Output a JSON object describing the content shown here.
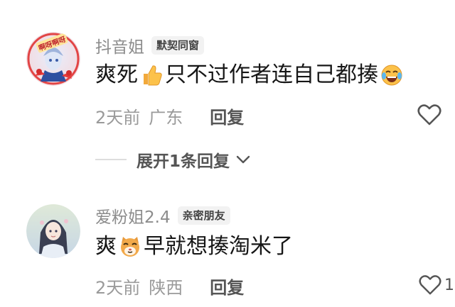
{
  "comments": [
    {
      "username": "抖音姐",
      "badge": "默契同窗",
      "avatar_text": "啊呀啊呀",
      "text_before": "爽死",
      "emoji1": "thumbs-up",
      "text_middle": "只不过作者连自己都揍",
      "emoji2": "laughing-tears",
      "time": "2天前",
      "location": "广东",
      "reply_label": "回复"
    },
    {
      "username": "爱粉姐2.4",
      "badge": "亲密朋友",
      "text_before": "爽",
      "emoji1": "cat-face",
      "text_after": "早就想揍淘米了",
      "time": "2天前",
      "location": "陕西",
      "reply_label": "回复",
      "like_count": "1"
    }
  ],
  "expand": {
    "label": "展开1条回复"
  },
  "colors": {
    "username": "#8c8c8c",
    "meta": "#9a9a9a",
    "badge_bg": "#f2f2f2",
    "text": "#161616"
  }
}
